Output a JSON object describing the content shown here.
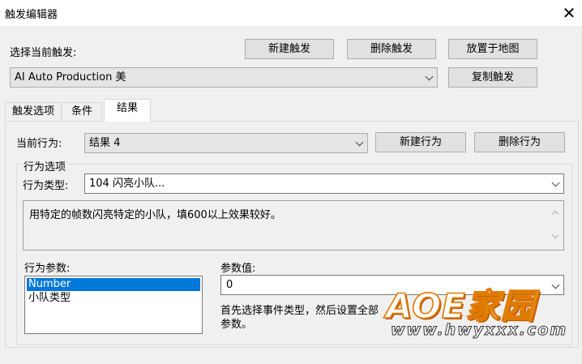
{
  "window": {
    "title": "触发编辑器"
  },
  "trigger_section": {
    "select_label": "选择当前触发:",
    "current_trigger": "AI Auto Production 美",
    "new_button": "新建触发",
    "delete_button": "删除触发",
    "place_button": "放置于地图",
    "copy_button": "复制触发"
  },
  "tabs": [
    {
      "label": "触发选项",
      "active": false
    },
    {
      "label": "条件",
      "active": false
    },
    {
      "label": "结果",
      "active": true
    }
  ],
  "result_panel": {
    "current_action_label": "当前行为:",
    "current_action": "结果 4",
    "new_action_button": "新建行为",
    "delete_action_button": "删除行为",
    "group_title": "行为选项",
    "action_type_label": "行为类型:",
    "action_type": "104 闪亮小队...",
    "description": "用特定的帧数闪亮特定的小队，填600以上效果较好。",
    "params_label": "行为参数:",
    "params": [
      {
        "label": "Number",
        "selected": true
      },
      {
        "label": "小队类型",
        "selected": false
      }
    ],
    "param_value_label": "参数值:",
    "param_value": "0",
    "hint_line1": "首先选择事件类型，然后设置全部",
    "hint_line2": "参数。"
  },
  "watermark": {
    "main": "AOE家园",
    "url": "www.hwyxxx.com"
  },
  "colors": {
    "selection": "#0078d7",
    "watermark_accent": "#e07b00"
  }
}
